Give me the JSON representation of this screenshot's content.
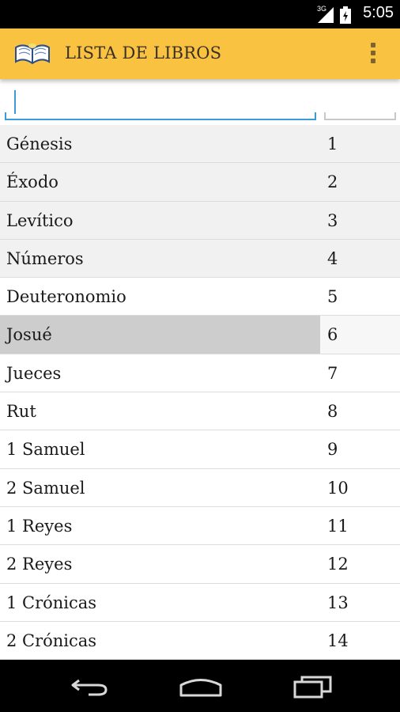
{
  "status_bar": {
    "network": "3G",
    "time": "5:05"
  },
  "action_bar": {
    "title": "LISTA DE LIBROS",
    "logo_icon": "open-book-icon",
    "overflow_icon": "overflow-menu-icon",
    "background": "#f9c341"
  },
  "filters": {
    "search_value": "",
    "number_value": "",
    "focus_color": "#3a9bd6"
  },
  "books": [
    {
      "name": "Génesis",
      "number": "1"
    },
    {
      "name": "Éxodo",
      "number": "2"
    },
    {
      "name": "Levítico",
      "number": "3"
    },
    {
      "name": "Números",
      "number": "4"
    },
    {
      "name": "Deuteronomio",
      "number": "5"
    },
    {
      "name": "Josué",
      "number": "6"
    },
    {
      "name": "Jueces",
      "number": "7"
    },
    {
      "name": "Rut",
      "number": "8"
    },
    {
      "name": "1 Samuel",
      "number": "9"
    },
    {
      "name": "2 Samuel",
      "number": "10"
    },
    {
      "name": "1 Reyes",
      "number": "11"
    },
    {
      "name": "2 Reyes",
      "number": "12"
    },
    {
      "name": "1 Crónicas",
      "number": "13"
    },
    {
      "name": "2 Crónicas",
      "number": "14"
    }
  ],
  "selected_book": "Josué",
  "nav_bar": {
    "back_icon": "back-icon",
    "home_icon": "home-icon",
    "recents_icon": "recents-icon"
  }
}
